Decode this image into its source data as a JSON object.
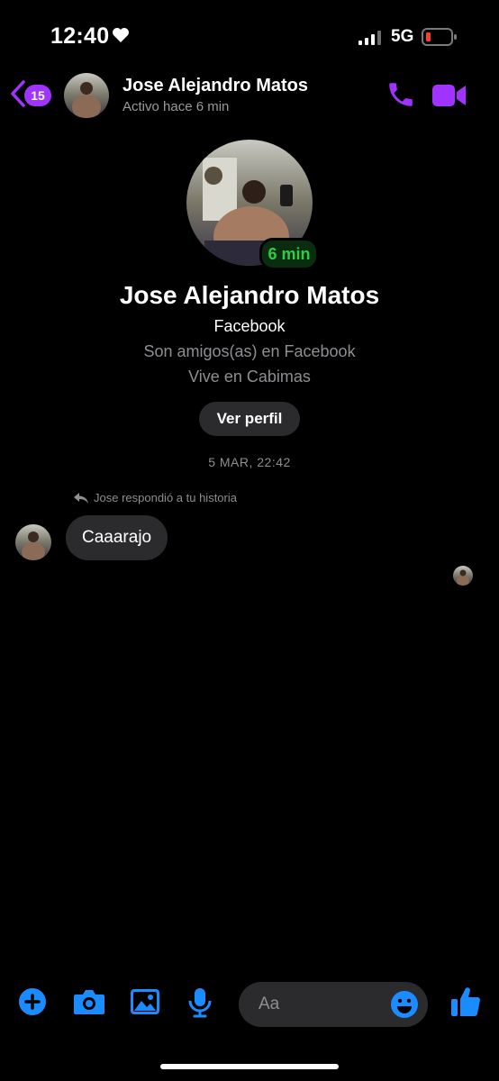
{
  "status_bar": {
    "time": "12:40",
    "network": "5G"
  },
  "header": {
    "unread_count": "15",
    "contact_name": "Jose Alejandro Matos",
    "status": "Activo hace 6 min"
  },
  "profile": {
    "active_badge": "6 min",
    "name": "Jose Alejandro Matos",
    "source": "Facebook",
    "friends_line": "Son amigos(as) en Facebook",
    "location_line": "Vive en Cabimas",
    "view_profile_label": "Ver perfil"
  },
  "conversation": {
    "date_separator": "5 MAR, 22:42",
    "reply_note": "Jose respondió a tu historia",
    "messages": [
      {
        "text": "Caaarajo"
      }
    ]
  },
  "composer": {
    "placeholder": "Aa"
  },
  "colors": {
    "accent_purple": "#a033ff",
    "icon_blue": "#1a8cff",
    "online_green": "#31cc46"
  }
}
